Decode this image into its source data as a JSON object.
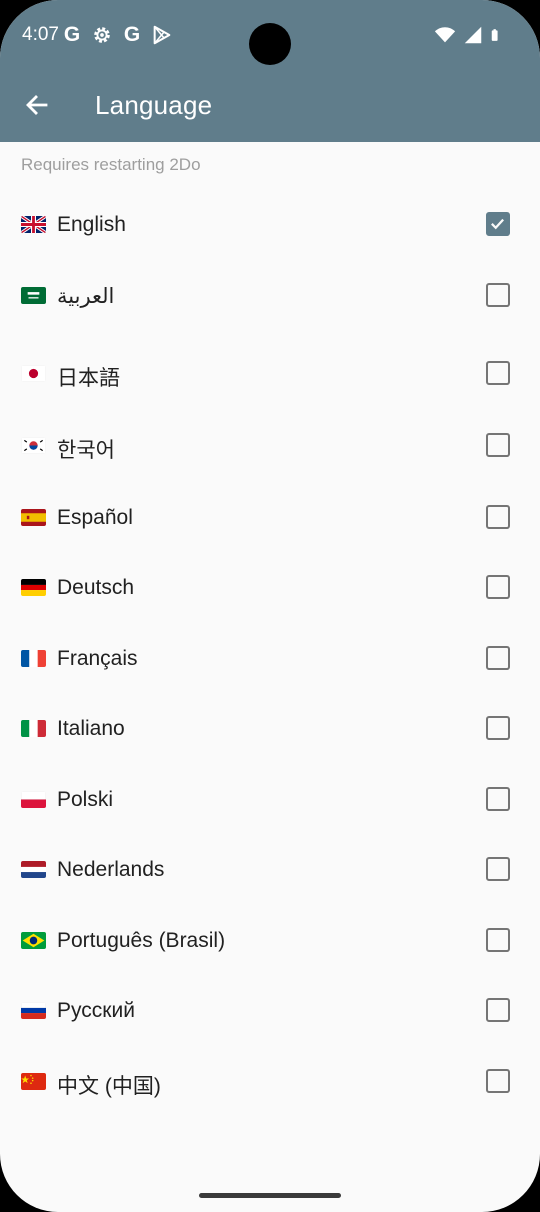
{
  "status_bar": {
    "time": "4:07",
    "left_icons": [
      "google-g-icon",
      "settings-gear-icon",
      "google-g-icon",
      "play-store-icon"
    ],
    "right_icons": [
      "wifi-icon",
      "cell-signal-icon",
      "battery-icon"
    ],
    "google_letter": "G"
  },
  "appbar": {
    "title": "Language",
    "back_icon": "arrow-left-icon",
    "background": "#607d8b"
  },
  "note": "Requires restarting 2Do",
  "languages": [
    {
      "label": "English",
      "flag": "gb",
      "checked": true
    },
    {
      "label": "العربية",
      "flag": "sa",
      "checked": false
    },
    {
      "label": "日本語",
      "flag": "jp",
      "checked": false
    },
    {
      "label": "한국어",
      "flag": "kr",
      "checked": false
    },
    {
      "label": "Español",
      "flag": "es",
      "checked": false
    },
    {
      "label": "Deutsch",
      "flag": "de",
      "checked": false
    },
    {
      "label": "Français",
      "flag": "fr",
      "checked": false
    },
    {
      "label": "Italiano",
      "flag": "it",
      "checked": false
    },
    {
      "label": "Polski",
      "flag": "pl",
      "checked": false
    },
    {
      "label": "Nederlands",
      "flag": "nl",
      "checked": false
    },
    {
      "label": "Português (Brasil)",
      "flag": "br",
      "checked": false
    },
    {
      "label": "Русский",
      "flag": "ru",
      "checked": false
    },
    {
      "label": "中文 (中国)",
      "flag": "cn",
      "checked": false
    }
  ],
  "colors": {
    "accent": "#607d8b",
    "checkbox_border": "#757575",
    "note_text": "#9e9e9e"
  }
}
